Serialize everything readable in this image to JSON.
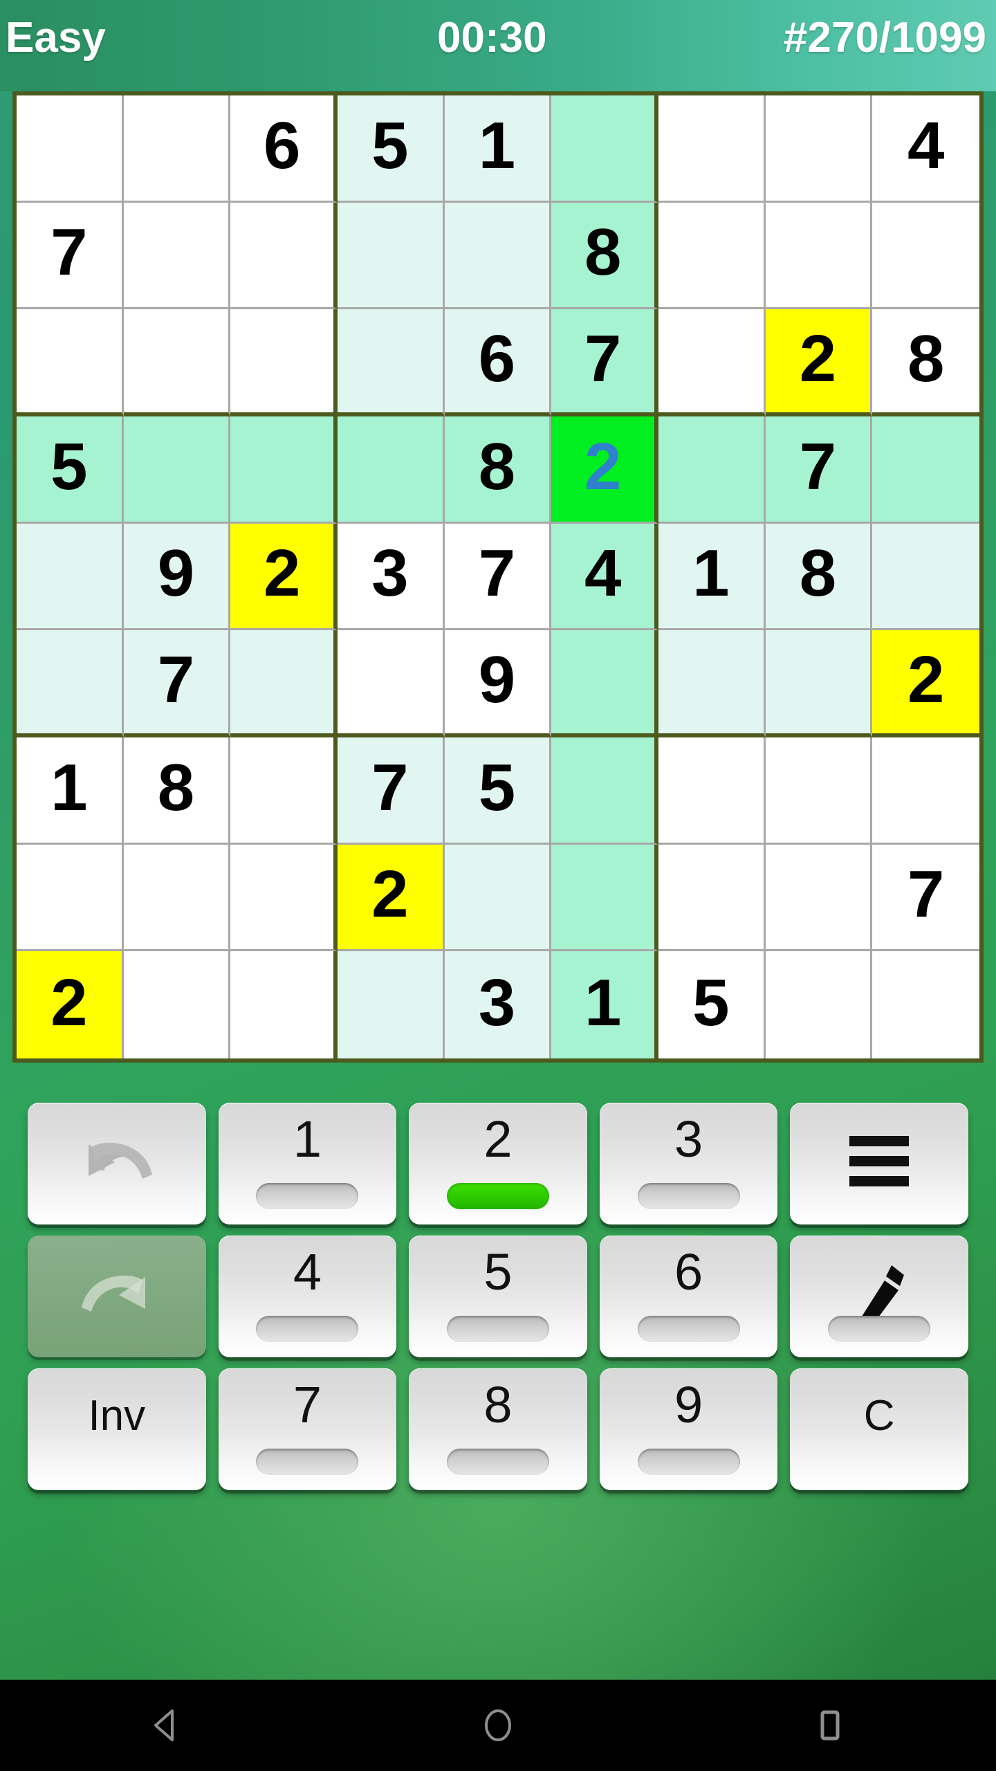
{
  "header": {
    "difficulty": "Easy",
    "timer": "00:30",
    "puzzle_index": "#270/1099"
  },
  "board": {
    "selected_cell": {
      "row": 4,
      "col": 6,
      "value": "2"
    },
    "active_digit": "2",
    "rows": [
      [
        {
          "v": "",
          "hl": ""
        },
        {
          "v": "",
          "hl": ""
        },
        {
          "v": "6",
          "hl": ""
        },
        {
          "v": "5",
          "hl": "soft"
        },
        {
          "v": "1",
          "hl": "soft"
        },
        {
          "v": "",
          "hl": "mint"
        },
        {
          "v": "",
          "hl": ""
        },
        {
          "v": "",
          "hl": ""
        },
        {
          "v": "4",
          "hl": ""
        }
      ],
      [
        {
          "v": "7",
          "hl": ""
        },
        {
          "v": "",
          "hl": ""
        },
        {
          "v": "",
          "hl": ""
        },
        {
          "v": "",
          "hl": "soft"
        },
        {
          "v": "",
          "hl": "soft"
        },
        {
          "v": "8",
          "hl": "mint"
        },
        {
          "v": "",
          "hl": ""
        },
        {
          "v": "",
          "hl": ""
        },
        {
          "v": "",
          "hl": ""
        }
      ],
      [
        {
          "v": "",
          "hl": ""
        },
        {
          "v": "",
          "hl": ""
        },
        {
          "v": "",
          "hl": ""
        },
        {
          "v": "",
          "hl": "soft"
        },
        {
          "v": "6",
          "hl": "soft"
        },
        {
          "v": "7",
          "hl": "mint"
        },
        {
          "v": "",
          "hl": ""
        },
        {
          "v": "2",
          "hl": "yellow"
        },
        {
          "v": "8",
          "hl": ""
        }
      ],
      [
        {
          "v": "5",
          "hl": "mint"
        },
        {
          "v": "",
          "hl": "mint"
        },
        {
          "v": "",
          "hl": "mint"
        },
        {
          "v": "",
          "hl": "mint"
        },
        {
          "v": "8",
          "hl": "mint"
        },
        {
          "v": "2",
          "hl": "sel"
        },
        {
          "v": "",
          "hl": "mint"
        },
        {
          "v": "7",
          "hl": "mint"
        },
        {
          "v": "",
          "hl": "mint"
        }
      ],
      [
        {
          "v": "",
          "hl": "soft"
        },
        {
          "v": "9",
          "hl": "soft"
        },
        {
          "v": "2",
          "hl": "yellow"
        },
        {
          "v": "3",
          "hl": ""
        },
        {
          "v": "7",
          "hl": ""
        },
        {
          "v": "4",
          "hl": "mint"
        },
        {
          "v": "1",
          "hl": "soft"
        },
        {
          "v": "8",
          "hl": "soft"
        },
        {
          "v": "",
          "hl": "soft"
        }
      ],
      [
        {
          "v": "",
          "hl": "soft"
        },
        {
          "v": "7",
          "hl": "soft"
        },
        {
          "v": "",
          "hl": "soft"
        },
        {
          "v": "",
          "hl": ""
        },
        {
          "v": "9",
          "hl": ""
        },
        {
          "v": "",
          "hl": "mint"
        },
        {
          "v": "",
          "hl": "soft"
        },
        {
          "v": "",
          "hl": "soft"
        },
        {
          "v": "2",
          "hl": "yellow"
        }
      ],
      [
        {
          "v": "1",
          "hl": ""
        },
        {
          "v": "8",
          "hl": ""
        },
        {
          "v": "",
          "hl": ""
        },
        {
          "v": "7",
          "hl": "soft"
        },
        {
          "v": "5",
          "hl": "soft"
        },
        {
          "v": "",
          "hl": "mint"
        },
        {
          "v": "",
          "hl": ""
        },
        {
          "v": "",
          "hl": ""
        },
        {
          "v": "",
          "hl": ""
        }
      ],
      [
        {
          "v": "",
          "hl": ""
        },
        {
          "v": "",
          "hl": ""
        },
        {
          "v": "",
          "hl": ""
        },
        {
          "v": "2",
          "hl": "yellow"
        },
        {
          "v": "",
          "hl": "soft"
        },
        {
          "v": "",
          "hl": "mint"
        },
        {
          "v": "",
          "hl": ""
        },
        {
          "v": "",
          "hl": ""
        },
        {
          "v": "7",
          "hl": ""
        }
      ],
      [
        {
          "v": "2",
          "hl": "yellow"
        },
        {
          "v": "",
          "hl": ""
        },
        {
          "v": "",
          "hl": ""
        },
        {
          "v": "",
          "hl": "soft"
        },
        {
          "v": "3",
          "hl": "soft"
        },
        {
          "v": "1",
          "hl": "mint"
        },
        {
          "v": "5",
          "hl": ""
        },
        {
          "v": "",
          "hl": ""
        },
        {
          "v": "",
          "hl": ""
        }
      ]
    ]
  },
  "keypad": {
    "keys": [
      {
        "id": "undo",
        "label": "",
        "icon": "undo-icon",
        "kind": "icon",
        "bar": "none",
        "disabled": false
      },
      {
        "id": "num-1",
        "label": "1",
        "icon": "",
        "kind": "num",
        "bar": "normal",
        "disabled": false
      },
      {
        "id": "num-2",
        "label": "2",
        "icon": "",
        "kind": "num",
        "bar": "active",
        "disabled": false
      },
      {
        "id": "num-3",
        "label": "3",
        "icon": "",
        "kind": "num",
        "bar": "normal",
        "disabled": false
      },
      {
        "id": "menu",
        "label": "",
        "icon": "hamburger-icon",
        "kind": "icon",
        "bar": "none",
        "disabled": false
      },
      {
        "id": "redo",
        "label": "",
        "icon": "redo-icon",
        "kind": "icon",
        "bar": "none",
        "disabled": true
      },
      {
        "id": "num-4",
        "label": "4",
        "icon": "",
        "kind": "num",
        "bar": "normal",
        "disabled": false
      },
      {
        "id": "num-5",
        "label": "5",
        "icon": "",
        "kind": "num",
        "bar": "normal",
        "disabled": false
      },
      {
        "id": "num-6",
        "label": "6",
        "icon": "",
        "kind": "num",
        "bar": "normal",
        "disabled": false
      },
      {
        "id": "pencil",
        "label": "",
        "icon": "pencil-icon",
        "kind": "icon",
        "bar": "normal",
        "disabled": false
      },
      {
        "id": "inv",
        "label": "Inv",
        "icon": "",
        "kind": "text",
        "bar": "none",
        "disabled": false
      },
      {
        "id": "num-7",
        "label": "7",
        "icon": "",
        "kind": "num",
        "bar": "normal",
        "disabled": false
      },
      {
        "id": "num-8",
        "label": "8",
        "icon": "",
        "kind": "num",
        "bar": "normal",
        "disabled": false
      },
      {
        "id": "num-9",
        "label": "9",
        "icon": "",
        "kind": "num",
        "bar": "normal",
        "disabled": false
      },
      {
        "id": "clear",
        "label": "C",
        "icon": "",
        "kind": "text",
        "bar": "none",
        "disabled": false
      }
    ]
  },
  "navbar": {
    "back": "back-icon",
    "home": "home-icon",
    "recents": "recents-icon"
  },
  "colors": {
    "selected_cell": "#00ef20",
    "selected_value": "#2f81cd",
    "match_highlight": "#ffff00",
    "row_col_highlight": "#a6f3d2",
    "box_highlight": "#e2f6f1",
    "grid_border": "#4d5a1e",
    "grid_line": "#a8a8a8",
    "active_bar": "#2dc800",
    "header_text": "#ffffff"
  }
}
